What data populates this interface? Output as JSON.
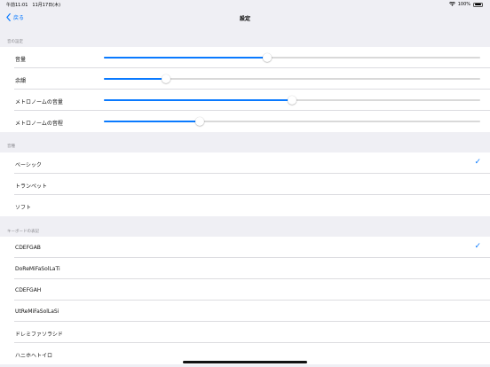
{
  "status_bar": {
    "time": "午前11:01　11月17日(木)",
    "battery": "100%"
  },
  "nav": {
    "back_label": "戻る",
    "title": "設定"
  },
  "sound_settings": {
    "header": "音の設定",
    "rows": [
      {
        "label": "音量",
        "value": 0.435
      },
      {
        "label": "余韻",
        "value": 0.165
      },
      {
        "label": "メトロノームの音量",
        "value": 0.5
      },
      {
        "label": "メトロノームの音程",
        "value": 0.255
      }
    ]
  },
  "timbre": {
    "header": "音種",
    "options": [
      "ベーシック",
      "トランペット",
      "ソフト"
    ],
    "selected": 0
  },
  "keyboard_notation": {
    "header": "キーボードの表記",
    "options": [
      "CDEFGAB",
      "DoReMiFaSolLaTi",
      "CDEFGAH",
      "UtReMiFaSolLaSi",
      "ドレミファソラシド",
      "ハニホヘトイロ"
    ],
    "selected": 0
  },
  "colors": {
    "accent": "#0a7aff",
    "background": "#efeff4"
  }
}
